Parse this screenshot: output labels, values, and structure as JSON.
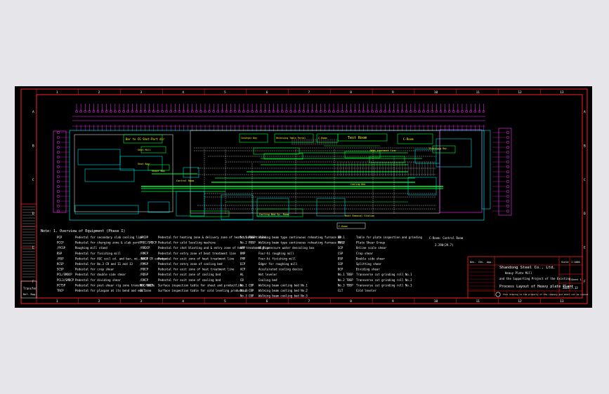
{
  "colors": {
    "background": "#000000",
    "frame": "#ff2020",
    "grid": "#ff00ff",
    "equipment": "#00ff00",
    "structure": "#00ffff",
    "label": "#ffff00",
    "text": "#ffffff"
  },
  "border_ticks": {
    "top": [
      "1",
      "2",
      "3",
      "4",
      "5",
      "6",
      "7",
      "8",
      "9",
      "10",
      "11",
      "12",
      "13"
    ],
    "bottom": [
      "1",
      "2",
      "3",
      "4",
      "5",
      "6",
      "7",
      "8",
      "9",
      "10",
      "11",
      "12",
      "13"
    ],
    "left": [
      "A",
      "B",
      "C",
      "D",
      "E",
      "F"
    ],
    "right": [
      "A",
      "B",
      "C",
      "D",
      "E",
      "F"
    ]
  },
  "area_labels": [
    {
      "id": "north-area",
      "text": "Bar to CG Shot-Part dir"
    },
    {
      "id": "shot-mill",
      "text": "Shot Mill"
    },
    {
      "id": "shot-bay",
      "text": "Shot Bay"
    },
    {
      "id": "shear-bay",
      "text": "Shear Bay"
    },
    {
      "id": "control-room",
      "text": "Control Room"
    },
    {
      "id": "conveyor-bay",
      "text": "Conveyor Bay"
    },
    {
      "id": "receiving-bay",
      "text": "Receiving Table Portal"
    },
    {
      "id": "c-room",
      "text": "C-Room"
    },
    {
      "id": "test-room",
      "text": "Test Room"
    },
    {
      "id": "c-room-2",
      "text": "C-Room"
    },
    {
      "id": "heat-treatment",
      "text": "Heat treatment line"
    },
    {
      "id": "cooling-bed",
      "text": "Cooling Bed"
    },
    {
      "id": "cooling-bed-room",
      "text": "Cooling Bed Sp.-Room"
    },
    {
      "id": "heat-removal",
      "text": "Heat Removal Station"
    },
    {
      "id": "c-room-bottom",
      "text": "C-Room"
    },
    {
      "id": "finishing-bay",
      "text": "Finishing Bay"
    }
  ],
  "note_heading": "Note:  1. Overview of Equipment (Phase I)",
  "legend": [
    {
      "code": "PCP",
      "desc": "Pedestal for secondary slab cooling line"
    },
    {
      "code": "PCCP",
      "desc": "Pedestal for charging zone & slab yard"
    },
    {
      "code": "/PCSP",
      "desc": "Roughing mill stand"
    },
    {
      "code": "RSP",
      "desc": "Pedestal for finishing mill"
    },
    {
      "code": "/RSP",
      "desc": "Pedestal for AGC coil cd. and bar, mi. No.3 CR conveyor"
    },
    {
      "code": "RCSP",
      "desc": "Pedestal for No.3 CR and 11 and 13"
    },
    {
      "code": "SCSP",
      "desc": "Pedestal for crop shear"
    },
    {
      "code": "PCL/SMDCP",
      "desc": "Pedestal for double side shear"
    },
    {
      "code": "PCL3/SMDCP",
      "desc": "Pedestal for dividing shear"
    },
    {
      "code": "PCTSP",
      "desc": "Pedestal for post-shear rig zone transfer table"
    },
    {
      "code": "TRCP",
      "desc": "Pedestal for plaspan at its bend and end zone"
    },
    {
      "code": "/PCDP",
      "desc": "Pedestal for heating zone & delivery zone of heat treatment line"
    },
    {
      "code": "PREC/SMDCP",
      "desc": "Pedestal for cold leveling machine"
    },
    {
      "code": "/RRDCP",
      "desc": "Pedestal for shot blasting and & entry zone of heat treatment line"
    },
    {
      "code": "/RMCP",
      "desc": "Pedestal for entry zone of heat treatment line"
    },
    {
      "code": "/RMDP",
      "desc": "Pedestal for exit zone of heat treatment line"
    },
    {
      "code": "/RMSP",
      "desc": "Pedestal for entry zone of cooling bed"
    },
    {
      "code": "/RDCP",
      "desc": "Pedestal for exit zone of heat treatment line"
    },
    {
      "code": "/RDSP",
      "desc": "Pedestal for exit zone of cooling bed"
    },
    {
      "code": "/DRCP",
      "desc": "Pedestal for exit zone of cooling bed"
    },
    {
      "code": "NDC/RRCP",
      "desc": "Surface inspection table for sheet and productline"
    },
    {
      "code": "CLT",
      "desc": "Surface inspection table for cold leveling production"
    },
    {
      "code": "No.1 PBSP",
      "desc": "Walking beam type continuous reheating furnace No.1"
    },
    {
      "code": "No.2 PBSP",
      "desc": "Walking beam type continuous reheating furnace No.2"
    },
    {
      "code": "HPP",
      "desc": "High pressure water descaling box"
    },
    {
      "code": "RMP",
      "desc": "Four-hi roughing mill"
    },
    {
      "code": "FMP",
      "desc": "Four-hi finishing mill"
    },
    {
      "code": "ECP",
      "desc": "Edger for roughing mill"
    },
    {
      "code": "ACP",
      "desc": "Accelerated cooling device"
    },
    {
      "code": "HL",
      "desc": "Hot leveler"
    },
    {
      "code": "CB",
      "desc": "Cooling bed"
    },
    {
      "code": "No.1 CBP",
      "desc": "Walking beam cooling bed No.1"
    },
    {
      "code": "No.2 CBP",
      "desc": "Walking beam cooling bed No.2"
    },
    {
      "code": "No.3 CBP",
      "desc": "Walking beam cooling bed No.3"
    },
    {
      "code": "CP",
      "desc": "Table for plate inspection and grinding"
    },
    {
      "code": "FPSP",
      "desc": "Plate Shear Group"
    },
    {
      "code": "SCP",
      "desc": "Online scale shear"
    },
    {
      "code": "CSP",
      "desc": "Crop shear"
    },
    {
      "code": "DSP",
      "desc": "Double side shear"
    },
    {
      "code": "SSP",
      "desc": "Splitting shear"
    },
    {
      "code": "DCP",
      "desc": "Dividing shear"
    },
    {
      "code": "No.1 TBSP",
      "desc": "Transverse cut grinding roll No.1"
    },
    {
      "code": "No.2 TBSP",
      "desc": "Transverse cut grinding roll No.2"
    },
    {
      "code": "No.3 TBSP",
      "desc": "Transverse cut grinding roll No.3"
    },
    {
      "code": "CLT",
      "desc": "Cold leveler"
    }
  ],
  "legend_extra": {
    "label": "C-Room:   Control Room",
    "value": "2.290(29.7)"
  },
  "title_block": {
    "company": "Shandong Steel Co., Ltd.",
    "sub1": "Heavy Plate Mill",
    "sub2": "and the Supporting Project of the Existing",
    "title": "Process Layout of Heavy plate Plant",
    "drawing_no": "2022.7.13",
    "scale_label": "Scale",
    "scale": "1:1000",
    "sheet": "Sheet 1",
    "revision_labels": [
      "Des.",
      "Chk.",
      "App."
    ],
    "footer": "This drawing is the property of the company and shall not be copied"
  },
  "side_panel": {
    "title": "Transfer",
    "label": "Ref. Dwg."
  }
}
